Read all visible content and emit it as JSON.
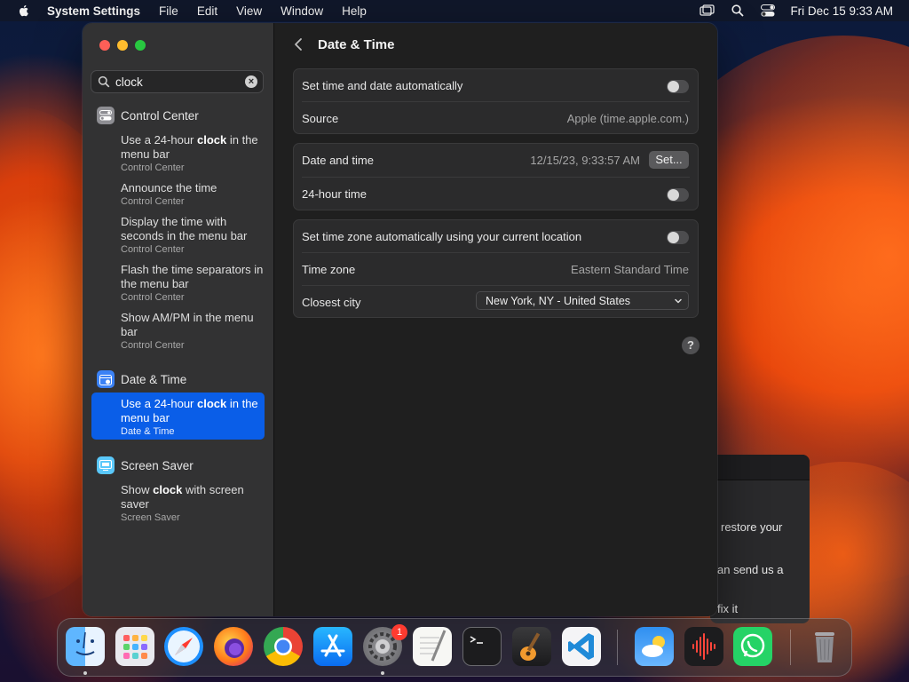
{
  "menubar": {
    "app_name": "System Settings",
    "menus": [
      "File",
      "Edit",
      "View",
      "Window",
      "Help"
    ],
    "status_icons": [
      "screen-mirroring-icon",
      "spotlight-search-icon",
      "control-center-icon"
    ],
    "clock": "Fri Dec 15  9:33 AM"
  },
  "sidebar": {
    "search": {
      "value": "clock",
      "clear_icon": "clear-search-icon"
    },
    "sections": [
      {
        "category": "Control Center",
        "icon": "control-center-icon",
        "results": [
          {
            "pre": "Use a 24-hour ",
            "match": "clock",
            "post": " in the menu bar",
            "sub": "Control Center"
          },
          {
            "pre": "Announce the time",
            "match": "",
            "post": "",
            "sub": "Control Center"
          },
          {
            "pre": "Display the time with seconds in the menu bar",
            "match": "",
            "post": "",
            "sub": "Control Center"
          },
          {
            "pre": "Flash the time separators in the menu bar",
            "match": "",
            "post": "",
            "sub": "Control Center"
          },
          {
            "pre": "Show AM/PM in the menu bar",
            "match": "",
            "post": "",
            "sub": "Control Center"
          }
        ]
      },
      {
        "category": "Date & Time",
        "icon": "date-time-icon",
        "results": [
          {
            "pre": "Use a 24-hour ",
            "match": "clock",
            "post": " in the menu bar",
            "sub": "Date & Time",
            "selected": true
          }
        ]
      },
      {
        "category": "Screen Saver",
        "icon": "screen-saver-icon",
        "results": [
          {
            "pre": "Show ",
            "match": "clock",
            "post": " with screen saver",
            "sub": "Screen Saver"
          }
        ]
      }
    ]
  },
  "content": {
    "title": "Date & Time",
    "group1": {
      "auto_time_label": "Set time and date automatically",
      "auto_time_on": false,
      "source_label": "Source",
      "source_value": "Apple (time.apple.com.)"
    },
    "group2": {
      "date_time_label": "Date and time",
      "date_time_value": "12/15/23, 9:33:57 AM",
      "set_button": "Set...",
      "hour24_label": "24-hour time",
      "hour24_on": false
    },
    "group3": {
      "auto_tz_label": "Set time zone automatically using your current location",
      "auto_tz_on": false,
      "tz_label": "Time zone",
      "tz_value": "Eastern Standard Time",
      "city_label": "Closest city",
      "city_value": "New York, NY - United States"
    },
    "help_label": "?"
  },
  "background_window": {
    "lines": [
      "restore your",
      "an send us a",
      "fix it"
    ]
  },
  "dock": {
    "apps": [
      "Finder",
      "Launchpad",
      "Safari",
      "Firefox",
      "Google Chrome",
      "App Store",
      "System Settings",
      "TextEdit",
      "Terminal",
      "GarageBand",
      "Visual Studio Code",
      "Weather",
      "Voice Memos",
      "WhatsApp",
      "Trash"
    ],
    "settings_badge": "1"
  }
}
